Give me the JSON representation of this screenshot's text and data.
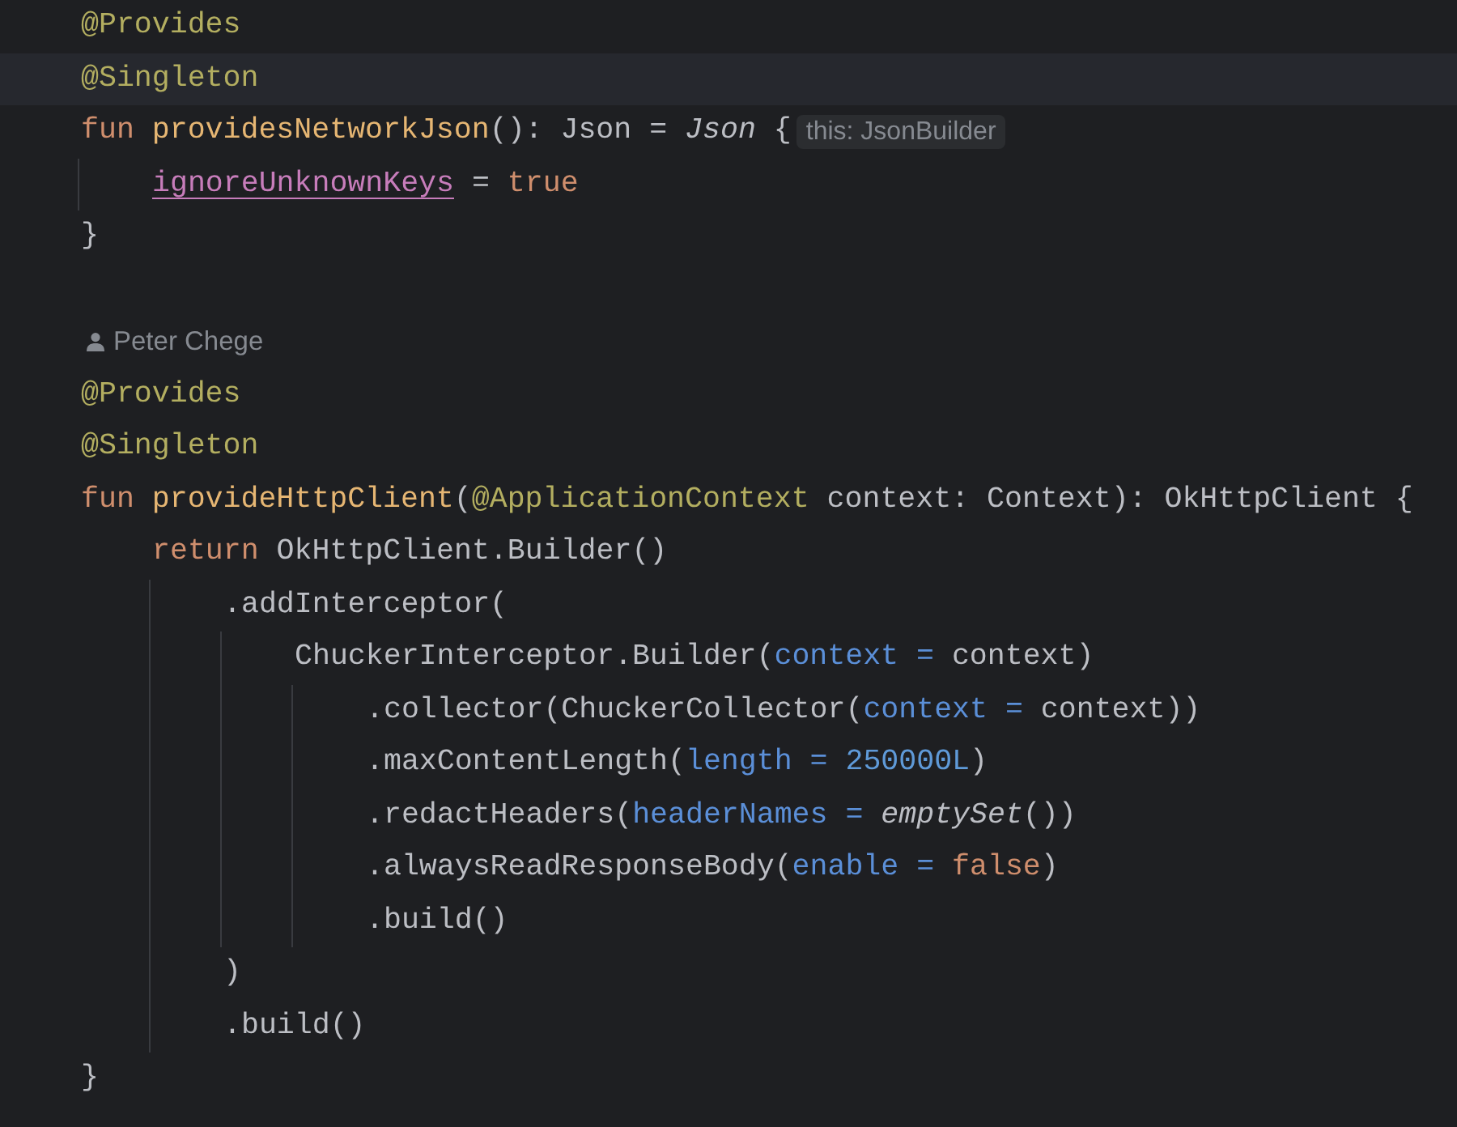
{
  "lines": [
    {
      "kind": "code",
      "current": false,
      "tokens": [
        {
          "text": "@Provides",
          "kind": "annotation"
        }
      ]
    },
    {
      "kind": "code",
      "current": true,
      "tokens": [
        {
          "text": "@Singleton",
          "kind": "annotation"
        }
      ]
    },
    {
      "kind": "code",
      "current": false,
      "tokens": [
        {
          "text": "fun ",
          "kind": "keyword"
        },
        {
          "text": "providesNetworkJson",
          "kind": "function"
        },
        {
          "text": "(): Json = ",
          "kind": "plain"
        },
        {
          "text": "Json",
          "kind": "italic"
        },
        {
          "text": " {",
          "kind": "plain"
        }
      ],
      "hint": "this: JsonBuilder",
      "children": [
        {
          "kind": "code",
          "current": false,
          "tokens": [
            {
              "text": "ignoreUnknownKeys",
              "kind": "property"
            },
            {
              "text": " = ",
              "kind": "plain"
            },
            {
              "text": "true",
              "kind": "keyword"
            }
          ]
        }
      ]
    },
    {
      "kind": "code",
      "current": false,
      "tokens": [
        {
          "text": "}",
          "kind": "plain"
        }
      ]
    },
    {
      "kind": "blank"
    },
    {
      "kind": "author",
      "text": "Peter Chege"
    },
    {
      "kind": "code",
      "current": false,
      "tokens": [
        {
          "text": "@Provides",
          "kind": "annotation"
        }
      ]
    },
    {
      "kind": "code",
      "current": false,
      "tokens": [
        {
          "text": "@Singleton",
          "kind": "annotation"
        }
      ]
    },
    {
      "kind": "code",
      "current": false,
      "tokens": [
        {
          "text": "fun ",
          "kind": "keyword"
        },
        {
          "text": "provideHttpClient",
          "kind": "function"
        },
        {
          "text": "(",
          "kind": "plain"
        },
        {
          "text": "@ApplicationContext",
          "kind": "annotation"
        },
        {
          "text": " context: Context): OkHttpClient {",
          "kind": "plain"
        }
      ],
      "children": [
        {
          "kind": "code",
          "current": false,
          "tokens": [
            {
              "text": "return ",
              "kind": "keyword"
            },
            {
              "text": "OkHttpClient.Builder()",
              "kind": "plain"
            }
          ],
          "children": [
            {
              "kind": "code",
              "current": false,
              "tokens": [
                {
                  "text": ".addInterceptor(",
                  "kind": "plain"
                }
              ],
              "children": [
                {
                  "kind": "code",
                  "current": false,
                  "tokens": [
                    {
                      "text": "ChuckerInterceptor.Builder(",
                      "kind": "plain"
                    },
                    {
                      "text": "context = ",
                      "kind": "param"
                    },
                    {
                      "text": "context)",
                      "kind": "plain"
                    }
                  ],
                  "children": [
                    {
                      "kind": "code",
                      "current": false,
                      "tokens": [
                        {
                          "text": ".collector(ChuckerCollector(",
                          "kind": "plain"
                        },
                        {
                          "text": "context = ",
                          "kind": "param"
                        },
                        {
                          "text": "context))",
                          "kind": "plain"
                        }
                      ]
                    },
                    {
                      "kind": "code",
                      "current": false,
                      "tokens": [
                        {
                          "text": ".maxContentLength(",
                          "kind": "plain"
                        },
                        {
                          "text": "length = ",
                          "kind": "param"
                        },
                        {
                          "text": "250000L",
                          "kind": "number"
                        },
                        {
                          "text": ")",
                          "kind": "plain"
                        }
                      ]
                    },
                    {
                      "kind": "code",
                      "current": false,
                      "tokens": [
                        {
                          "text": ".redactHeaders(",
                          "kind": "plain"
                        },
                        {
                          "text": "headerNames = ",
                          "kind": "param"
                        },
                        {
                          "text": "emptySet",
                          "kind": "italic"
                        },
                        {
                          "text": "())",
                          "kind": "plain"
                        }
                      ]
                    },
                    {
                      "kind": "code",
                      "current": false,
                      "tokens": [
                        {
                          "text": ".alwaysReadResponseBody(",
                          "kind": "plain"
                        },
                        {
                          "text": "enable = ",
                          "kind": "param"
                        },
                        {
                          "text": "false",
                          "kind": "keyword"
                        },
                        {
                          "text": ")",
                          "kind": "plain"
                        }
                      ]
                    },
                    {
                      "kind": "code",
                      "current": false,
                      "tokens": [
                        {
                          "text": ".build()",
                          "kind": "plain"
                        }
                      ]
                    }
                  ]
                }
              ]
            },
            {
              "kind": "code",
              "current": false,
              "tokens": [
                {
                  "text": ")",
                  "kind": "plain"
                }
              ]
            },
            {
              "kind": "code",
              "current": false,
              "tokens": [
                {
                  "text": ".build()",
                  "kind": "plain"
                }
              ]
            }
          ]
        }
      ]
    },
    {
      "kind": "code",
      "current": false,
      "tokens": [
        {
          "text": "}",
          "kind": "plain"
        }
      ]
    }
  ]
}
